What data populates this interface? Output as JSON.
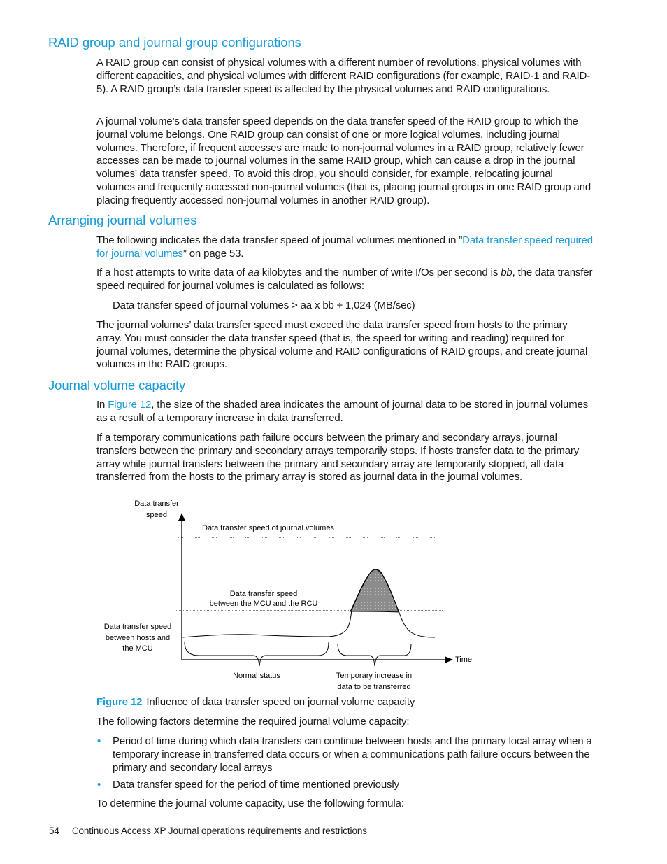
{
  "sections": [
    {
      "heading": "RAID group and journal group configurations",
      "paragraphs": [
        "A RAID group can consist of physical volumes with a different number of revolutions, physical volumes with different capacities, and physical volumes with different RAID configurations (for example, RAID-1 and RAID-5). A RAID group’s data transfer speed is affected by the physical volumes and RAID configurations.",
        "A journal volume’s data transfer speed depends on the data transfer speed of the RAID group to which the journal volume belongs. One RAID group can consist of one or more logical volumes, including journal volumes. Therefore, if frequent accesses are made to non-journal volumes in a RAID group, relatively fewer accesses can be made to journal volumes in the same RAID group, which can cause a drop in the journal volumes’ data transfer speed. To avoid this drop, you should consider, for example, relocating journal volumes and frequently accessed non-journal volumes (that is, placing journal groups in one RAID group and placing frequently accessed non-journal volumes in another RAID group)."
      ]
    },
    {
      "heading": "Arranging journal volumes",
      "p1_before": "The following indicates the data transfer speed of journal volumes mentioned in ”",
      "p1_link": "Data transfer speed required for journal volumes",
      "p1_after": "” on page 53.",
      "p2_a": "If a host attempts to write data of ",
      "p2_aa": "aa",
      "p2_b": " kilobytes and the number of write I/Os per second is ",
      "p2_bb": "bb",
      "p2_c": ", the data transfer speed required for journal volumes is calculated as follows:",
      "formula": "Data transfer speed of journal volumes > aa x bb ÷ 1,024 (MB/sec)",
      "p3": "The journal volumes’ data transfer speed must exceed the data transfer speed from hosts to the primary array. You must consider the data transfer speed (that is, the speed for writing and reading) required for journal volumes, determine the physical volume and RAID configurations of RAID groups, and create journal volumes in the RAID groups."
    },
    {
      "heading": "Journal volume capacity",
      "p1_before": "In ",
      "p1_link": "Figure 12",
      "p1_after": ", the size of the shaded area indicates the amount of journal data to be stored in journal volumes as a result of a temporary increase in data transferred.",
      "p2": "If a temporary communications path failure occurs between the primary and secondary arrays, journal transfers between the primary and secondary arrays temporarily stops. If hosts transfer data to the primary array while journal transfers between the primary and secondary array are temporarily stopped, all data transferred from the hosts to the primary array is stored as journal data in the journal volumes."
    }
  ],
  "figure": {
    "y_axis_label_1": "Data transfer",
    "y_axis_label_2": "speed",
    "x_axis_label": "Time",
    "journal_speed_label": "Data transfer speed of journal volumes",
    "mcu_rcu_label_1": "Data transfer speed",
    "mcu_rcu_label_2": "between the MCU and the RCU",
    "hosts_label_1": "Data transfer speed",
    "hosts_label_2": "between hosts and",
    "hosts_label_3": "the MCU",
    "normal_label": "Normal status",
    "temp_label_1": "Temporary increase in",
    "temp_label_2": "data to be transferred",
    "caption_label": "Figure 12",
    "caption_text": "Influence of data transfer speed on journal volume capacity"
  },
  "after_figure": {
    "intro": "The following factors determine the required journal volume capacity:",
    "bullets": [
      "Period of time during which data transfers can continue between hosts and the primary local array when a temporary increase in transferred data occurs or when a communications path failure occurs between the primary and secondary local arrays",
      "Data transfer speed for the period of time mentioned previously"
    ],
    "bullet_glyph": "•",
    "outro": "To determine the journal volume capacity, use the following formula:"
  },
  "footer": {
    "page_number": "54",
    "title": "Continuous Access XP Journal operations requirements and restrictions"
  },
  "colors": {
    "accent": "#1a9ad6",
    "shade": "#8c8c8c"
  }
}
